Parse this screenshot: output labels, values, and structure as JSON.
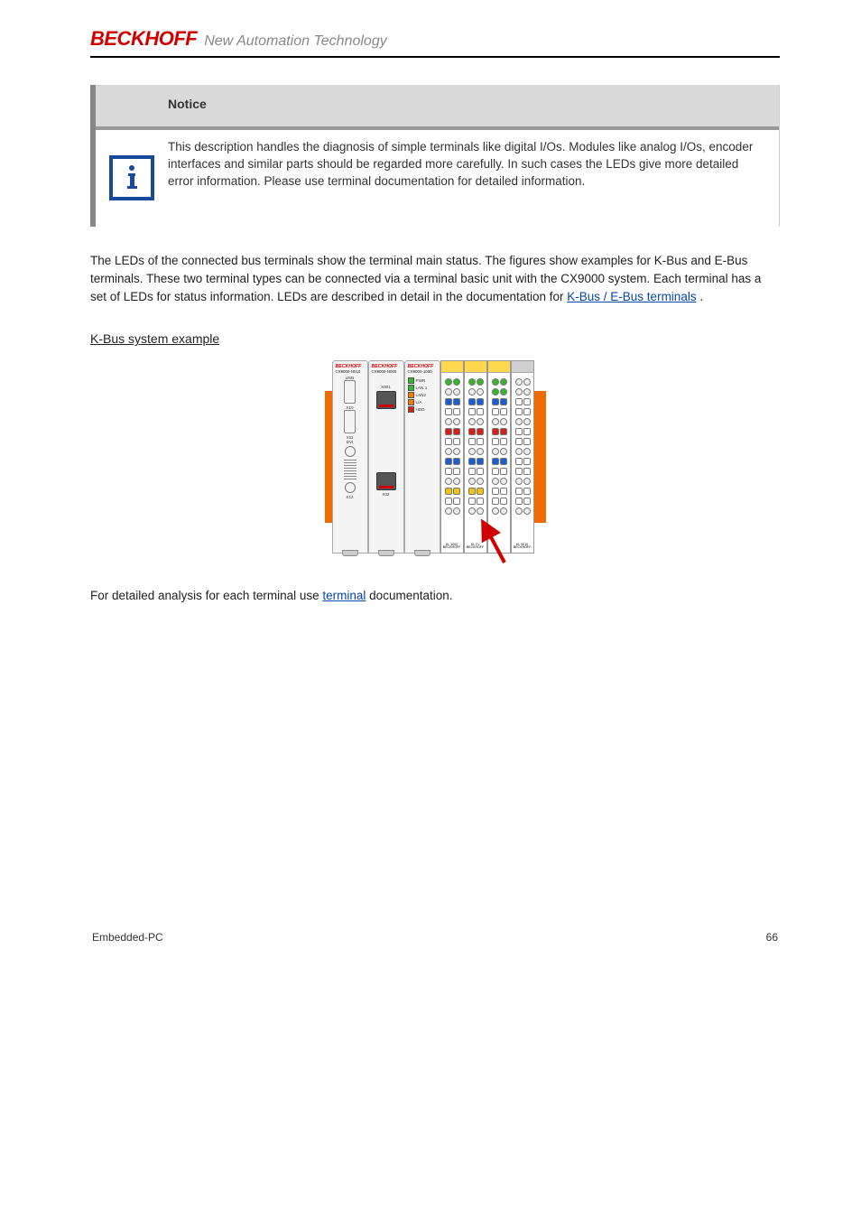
{
  "header": {
    "logo": "BECKHOFF",
    "tagline": "New Automation Technology"
  },
  "notice": {
    "title": "Notice",
    "body": "This description handles the diagnosis of simple terminals like digital I/Os. Modules like analog I/Os, encoder interfaces and similar parts should be regarded more carefully. In such cases the LEDs give more detailed error information. Please use terminal documentation for detailed information."
  },
  "para1": {
    "pre": "The LEDs of the connected bus terminals show the terminal main status. The figures show examples for K-Bus and E-Bus terminals. These two terminal types can be connected via a terminal basic unit with the CX9000 system. Each terminal has a set of LEDs for status information. LEDs are described in detail in the documentation for ",
    "link_text": "K-Bus / E-Bus terminals",
    "link_href": "#",
    "post": "."
  },
  "subheading": "K-Bus system example",
  "para2": {
    "pre": "For detailed analysis for each terminal use ",
    "link_text": "terminal",
    "post": " documentation."
  },
  "diagram": {
    "modules": [
      {
        "brand": "BECKHOFF",
        "model": "CX9000-N010",
        "labels": [
          "USB",
          "X10",
          "X11",
          "DVI",
          "X12"
        ]
      },
      {
        "brand": "BECKHOFF",
        "model": "CX9000-N000",
        "labels": [
          "X001",
          "X02"
        ]
      },
      {
        "brand": "BECKHOFF",
        "model": "CX9000-1000",
        "leds": [
          "PWR",
          "LAN 1",
          "LAN2",
          "L/A",
          "HDD"
        ]
      }
    ],
    "terminals": [
      {
        "name": "KL 1002",
        "top": "yellow"
      },
      {
        "name": "KL 21",
        "top": "yellow"
      },
      {
        "name": "",
        "top": "yellow"
      },
      {
        "name": "KL 9010",
        "top": "gray"
      }
    ]
  },
  "footer": {
    "left": "Embedded-PC",
    "right": "66"
  }
}
